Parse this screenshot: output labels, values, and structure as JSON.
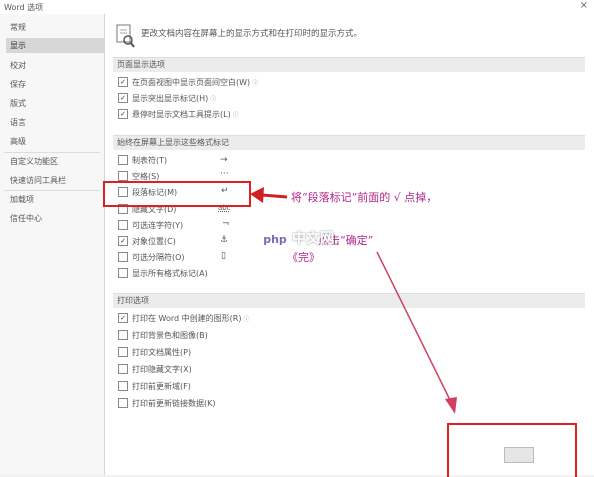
{
  "window": {
    "title": "Word 选项",
    "close": "×"
  },
  "sidebar": {
    "items": [
      "常规",
      "显示",
      "校对",
      "保存",
      "版式",
      "语言",
      "高级",
      "自定义功能区",
      "快速访问工具栏",
      "加载项",
      "信任中心"
    ],
    "selected": "显示"
  },
  "header": {
    "text": "更改文档内容在屏幕上的显示方式和在打印时的显示方式。"
  },
  "sections": {
    "page": {
      "title": "页面显示选项",
      "items": [
        "在页面视图中显示页面间空白(W)",
        "显示突出显示标记(H)",
        "悬停时显示文档工具提示(L)"
      ]
    },
    "marks": {
      "title": "始终在屏幕上显示这些格式标记",
      "items": [
        "制表符(T)",
        "空格(S)",
        "段落标记(M)",
        "隐藏文字(D)",
        "可选连字符(Y)",
        "对象位置(C)",
        "可选分隔符(O)",
        "显示所有格式标记(A)"
      ],
      "symbols": [
        "→",
        "···",
        "↵",
        "abc",
        "¬",
        "⚓",
        "▯",
        ""
      ]
    },
    "print": {
      "title": "打印选项",
      "items": [
        "打印在 Word 中创建的图形(R)",
        "打印背景色和图像(B)",
        "打印文档属性(P)",
        "打印隐藏文字(X)",
        "打印前更新域(F)",
        "打印前更新链接数据(K)"
      ]
    }
  },
  "annotation": {
    "line1": "将“段落标记”前面的 √ 点掉，",
    "line2": "点击“确定”",
    "line3": "《完》",
    "color": "#b0268a"
  },
  "watermark": {
    "brand": "php",
    "text": "中文网"
  },
  "highlight_color": "#e02020"
}
